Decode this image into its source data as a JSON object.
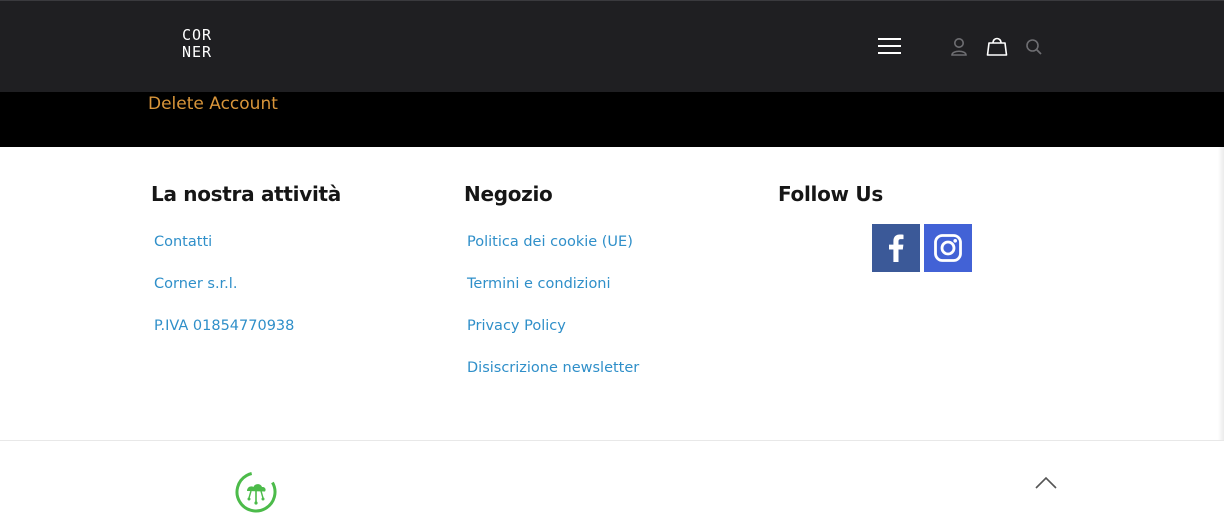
{
  "header": {
    "logo": {
      "line1": "COR",
      "line2": "NER"
    },
    "icons": {
      "menu": "hamburger-menu-icon",
      "user": "user-icon",
      "cart": "shopping-bag-icon",
      "search": "search-icon"
    }
  },
  "account": {
    "delete_label": "Delete Account"
  },
  "footer": {
    "columns": [
      {
        "title": "La nostra attività",
        "links": [
          "Contatti",
          "Corner s.r.l.",
          "P.IVA 01854770938"
        ]
      },
      {
        "title": "Negozio",
        "links": [
          "Politica dei cookie (UE)",
          "Termini e condizioni",
          "Privacy Policy",
          "Disiscrizione newsletter"
        ]
      },
      {
        "title": "Follow Us",
        "social": [
          {
            "name": "facebook-icon",
            "color": "#3b5998"
          },
          {
            "name": "instagram-icon",
            "color": "#4262d6"
          }
        ]
      }
    ],
    "badge_icon": "green-cloud-badge-icon",
    "scroll_top_icon": "chevron-up-icon"
  },
  "colors": {
    "topbar": "#1f1f22",
    "band": "#000000",
    "accent_orange": "#d8953a",
    "link_blue": "#2f8fc9",
    "heading": "#161616",
    "badge_green": "#4cbb4a"
  }
}
